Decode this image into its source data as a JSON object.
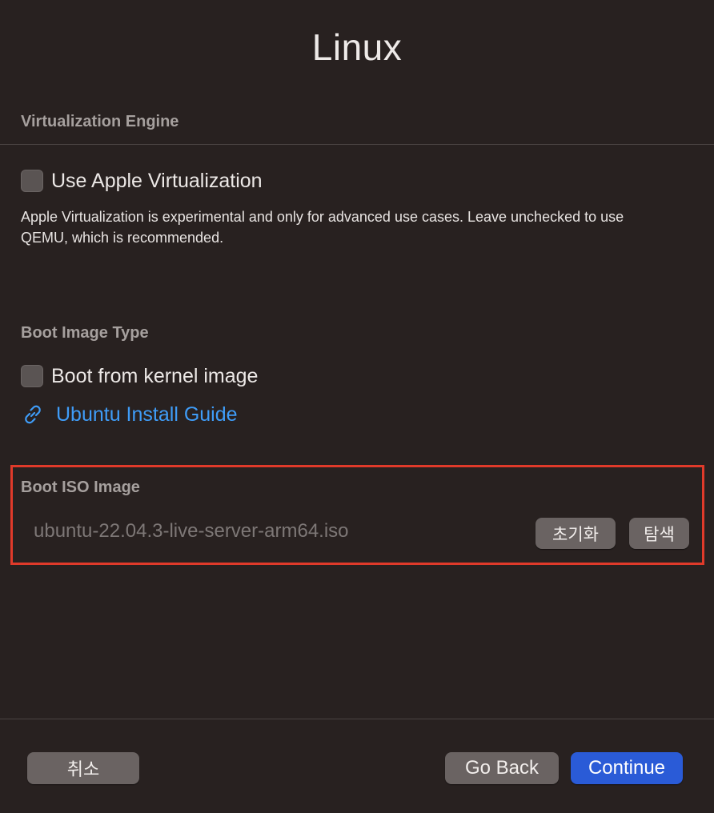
{
  "window": {
    "title": "Linux"
  },
  "virtualization": {
    "section_label": "Virtualization Engine",
    "checkbox_label": "Use Apple Virtualization",
    "checked": false,
    "help_text": "Apple Virtualization is experimental and only for advanced use cases. Leave unchecked to use QEMU, which is recommended."
  },
  "boot_image_type": {
    "section_label": "Boot Image Type",
    "checkbox_label": "Boot from kernel image",
    "checked": false,
    "guide_link": "Ubuntu Install Guide"
  },
  "boot_iso": {
    "section_label": "Boot ISO Image",
    "file_value": "ubuntu-22.04.3-live-server-arm64.iso",
    "clear_label": "초기화",
    "browse_label": "탐색"
  },
  "footer": {
    "cancel_label": "취소",
    "back_label": "Go Back",
    "continue_label": "Continue"
  },
  "colors": {
    "background": "#282120",
    "link": "#3f9cf7",
    "accent": "#2a5bd7",
    "highlight": "#e03a2a"
  }
}
